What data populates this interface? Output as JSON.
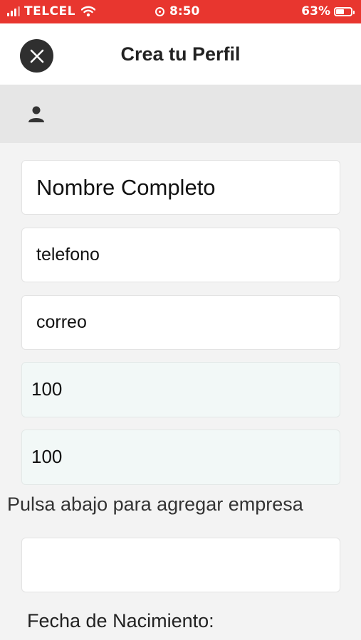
{
  "status_bar": {
    "carrier": "TELCEL",
    "time": "8:50",
    "battery_text": "63%",
    "battery_level": 0.63
  },
  "header": {
    "close_icon": "close-icon",
    "title": "Crea tu Perfil"
  },
  "avatar_icon": "person-icon",
  "form": {
    "name_placeholder": "Nombre Completo",
    "phone_placeholder": "telefono",
    "email_placeholder": "correo",
    "number_value_1": "100",
    "number_value_2": "100",
    "company_prompt": "Pulsa abajo para agregar empresa",
    "company_value": "",
    "dob_label": "Fecha de Nacimiento:"
  },
  "colors": {
    "status_bar": "#e8362f",
    "close_button": "#2f2f2f",
    "background": "#f3f3f3"
  }
}
